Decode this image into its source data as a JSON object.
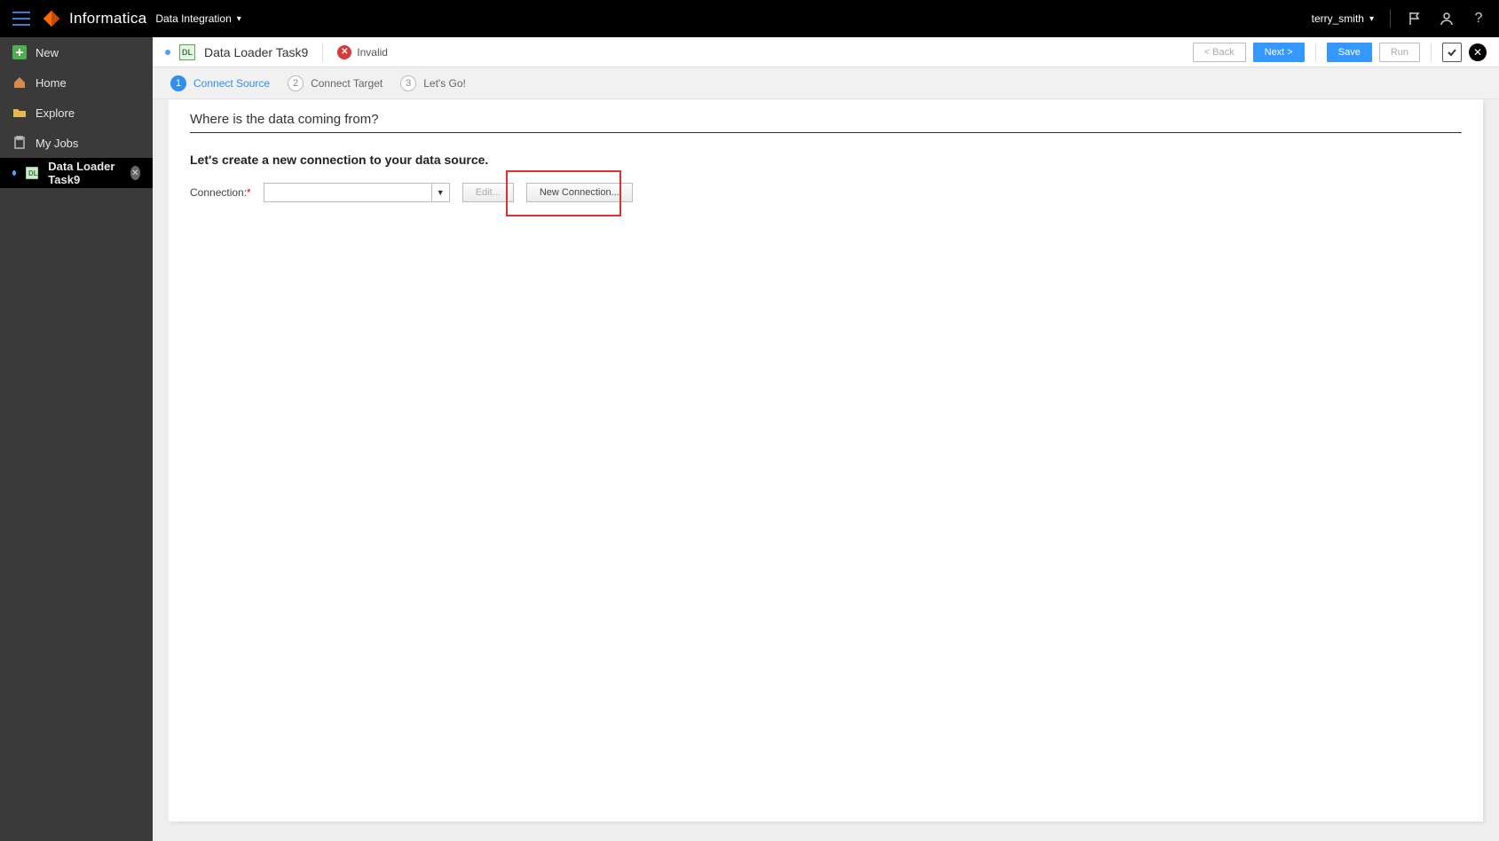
{
  "header": {
    "brand": "Informatica",
    "product": "Data Integration",
    "user": "terry_smith"
  },
  "sidebar": {
    "items": [
      {
        "label": "New"
      },
      {
        "label": "Home"
      },
      {
        "label": "Explore"
      },
      {
        "label": "My Jobs"
      },
      {
        "label": "Data Loader Task9"
      }
    ]
  },
  "toolbar": {
    "task_title": "Data Loader Task9",
    "invalid_label": "Invalid",
    "back_label": "< Back",
    "next_label": "Next >",
    "save_label": "Save",
    "run_label": "Run"
  },
  "stepper": {
    "steps": [
      {
        "num": "1",
        "label": "Connect Source"
      },
      {
        "num": "2",
        "label": "Connect Target"
      },
      {
        "num": "3",
        "label": "Let's Go!"
      }
    ]
  },
  "content": {
    "section_title": "Where is the data coming from?",
    "section_subtitle": "Let's create a new connection to your data source.",
    "connection_label": "Connection:",
    "connection_value": "",
    "edit_label": "Edit...",
    "new_connection_label": "New Connection..."
  }
}
